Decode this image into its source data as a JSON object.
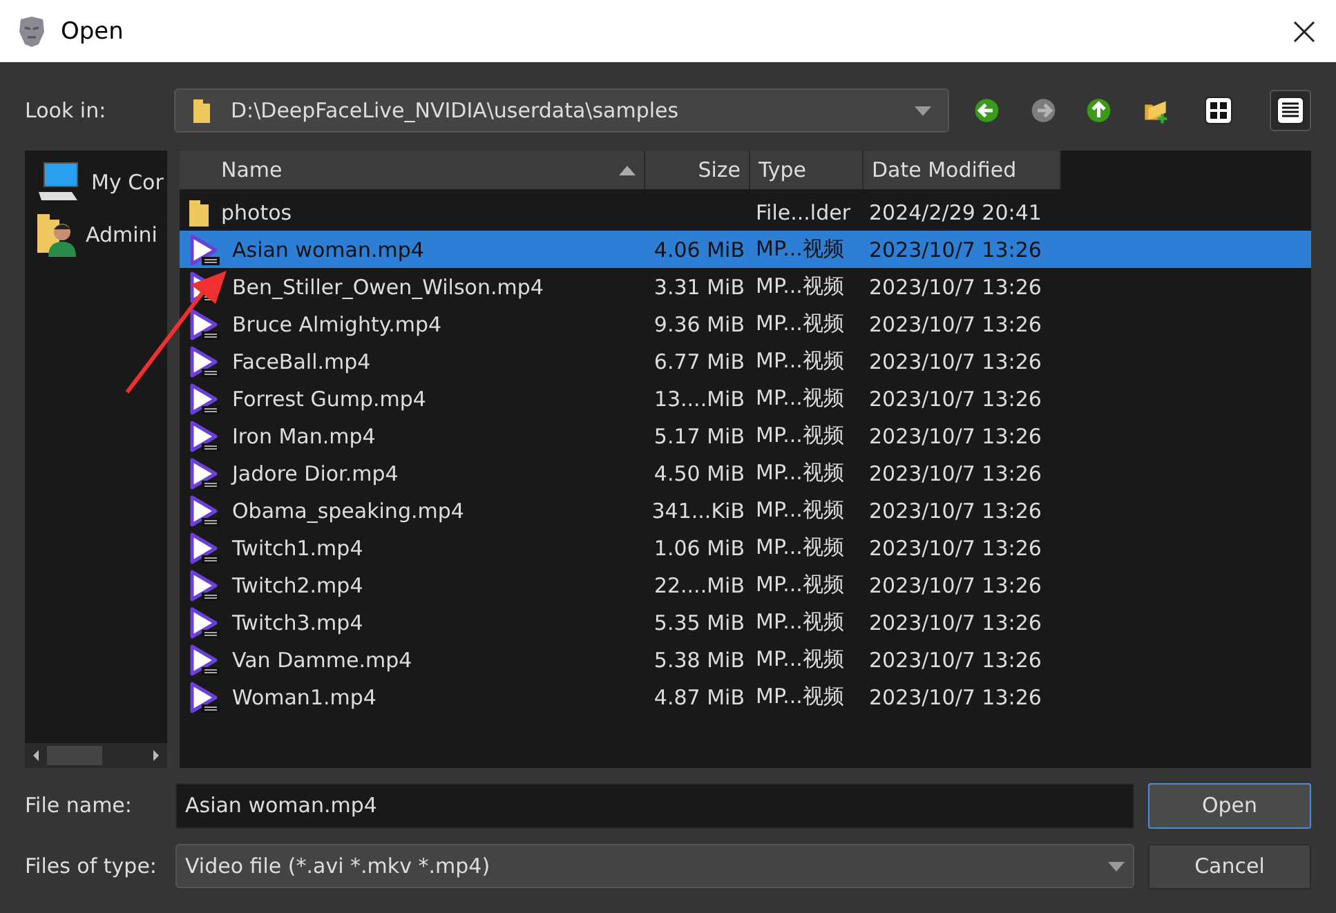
{
  "window": {
    "title": "Open"
  },
  "look_in": {
    "label": "Look in:",
    "path": "D:\\DeepFaceLive_NVIDIA\\userdata\\samples"
  },
  "toolbar": [
    {
      "kind": "back",
      "disabled": false
    },
    {
      "kind": "forward",
      "disabled": true
    },
    {
      "kind": "up",
      "disabled": false
    },
    {
      "kind": "new-folder"
    },
    {
      "kind": "list-view",
      "selected": false
    },
    {
      "kind": "detail-view",
      "selected": true
    }
  ],
  "sidebar": {
    "items": [
      {
        "kind": "computer",
        "label": "My Cor"
      },
      {
        "kind": "user",
        "label": "Admini"
      }
    ]
  },
  "table": {
    "columns": [
      {
        "label": "Name",
        "sorted": true
      },
      {
        "label": "Size",
        "sorted": false
      },
      {
        "label": "Type",
        "sorted": false
      },
      {
        "label": "Date Modified",
        "sorted": false
      }
    ],
    "rows": [
      {
        "kind": "folder",
        "name": "photos",
        "size": "",
        "type": "File...lder",
        "date": "2024/2/29 20:41",
        "selected": false
      },
      {
        "kind": "video",
        "name": "Asian woman.mp4",
        "size": "4.06 MiB",
        "type": "MP...视频",
        "date": "2023/10/7 13:26",
        "selected": true
      },
      {
        "kind": "video",
        "name": "Ben_Stiller_Owen_Wilson.mp4",
        "size": "3.31 MiB",
        "type": "MP...视频",
        "date": "2023/10/7 13:26",
        "selected": false
      },
      {
        "kind": "video",
        "name": "Bruce Almighty.mp4",
        "size": "9.36 MiB",
        "type": "MP...视频",
        "date": "2023/10/7 13:26",
        "selected": false
      },
      {
        "kind": "video",
        "name": "FaceBall.mp4",
        "size": "6.77 MiB",
        "type": "MP...视频",
        "date": "2023/10/7 13:26",
        "selected": false
      },
      {
        "kind": "video",
        "name": "Forrest Gump.mp4",
        "size": "13....MiB",
        "type": "MP...视频",
        "date": "2023/10/7 13:26",
        "selected": false
      },
      {
        "kind": "video",
        "name": "Iron Man.mp4",
        "size": "5.17 MiB",
        "type": "MP...视频",
        "date": "2023/10/7 13:26",
        "selected": false
      },
      {
        "kind": "video",
        "name": "Jadore Dior.mp4",
        "size": "4.50 MiB",
        "type": "MP...视频",
        "date": "2023/10/7 13:26",
        "selected": false
      },
      {
        "kind": "video",
        "name": "Obama_speaking.mp4",
        "size": "341...KiB",
        "type": "MP...视频",
        "date": "2023/10/7 13:26",
        "selected": false
      },
      {
        "kind": "video",
        "name": "Twitch1.mp4",
        "size": "1.06 MiB",
        "type": "MP...视频",
        "date": "2023/10/7 13:26",
        "selected": false
      },
      {
        "kind": "video",
        "name": "Twitch2.mp4",
        "size": "22....MiB",
        "type": "MP...视频",
        "date": "2023/10/7 13:26",
        "selected": false
      },
      {
        "kind": "video",
        "name": "Twitch3.mp4",
        "size": "5.35 MiB",
        "type": "MP...视频",
        "date": "2023/10/7 13:26",
        "selected": false
      },
      {
        "kind": "video",
        "name": "Van Damme.mp4",
        "size": "5.38 MiB",
        "type": "MP...视频",
        "date": "2023/10/7 13:26",
        "selected": false
      },
      {
        "kind": "video",
        "name": "Woman1.mp4",
        "size": "4.87 MiB",
        "type": "MP...视频",
        "date": "2023/10/7 13:26",
        "selected": false
      }
    ]
  },
  "file_name": {
    "label": "File name:",
    "value": "Asian woman.mp4"
  },
  "file_type": {
    "label": "Files of type:",
    "value": "Video file (*.avi *.mkv *.mp4)"
  },
  "buttons": [
    {
      "label": "Open",
      "default": true
    },
    {
      "label": "Cancel",
      "default": false
    }
  ]
}
